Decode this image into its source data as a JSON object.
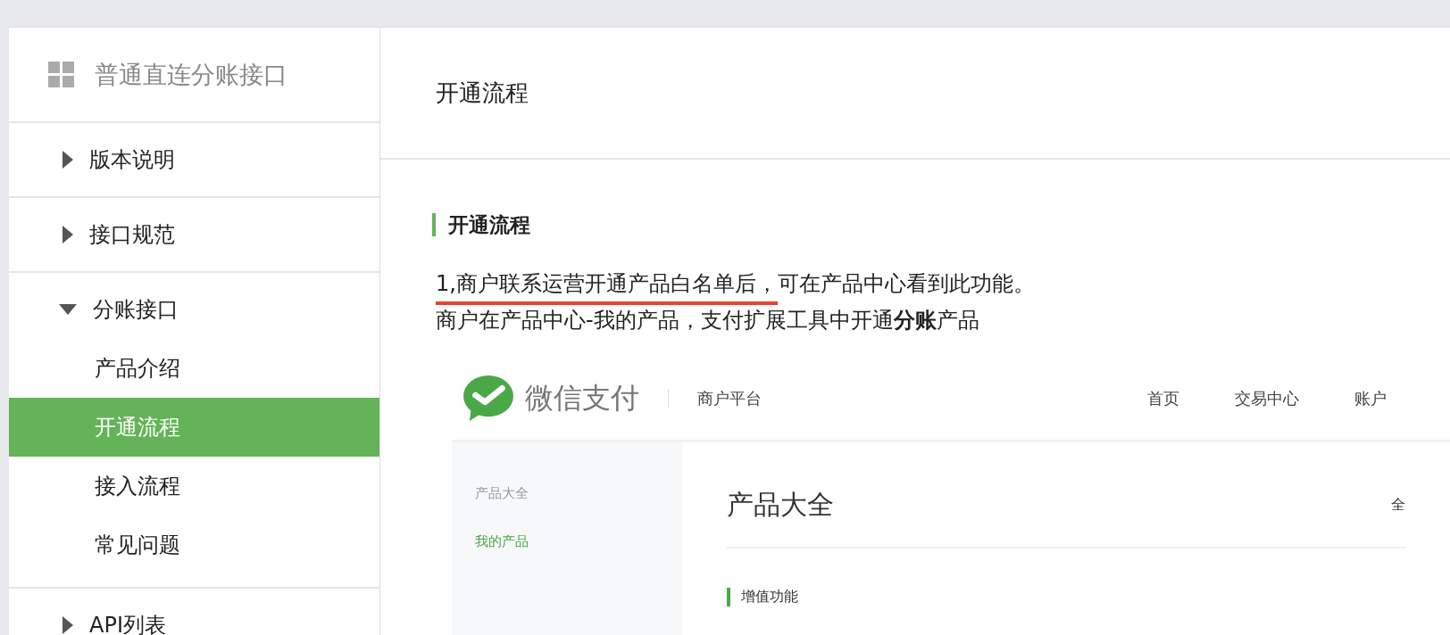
{
  "sidebar": {
    "title": "普通直连分账接口",
    "items": [
      {
        "label": "版本说明",
        "expanded": false
      },
      {
        "label": "接口规范",
        "expanded": false
      },
      {
        "label": "分账接口",
        "expanded": true,
        "children": [
          {
            "label": "产品介绍",
            "selected": false
          },
          {
            "label": "开通流程",
            "selected": true
          },
          {
            "label": "接入流程",
            "selected": false
          },
          {
            "label": "常见问题",
            "selected": false
          }
        ]
      },
      {
        "label": "API列表",
        "expanded": false
      }
    ]
  },
  "page": {
    "title": "开通流程",
    "section": "开通流程",
    "lines": [
      [
        {
          "text": "1,商户联系运营开通产品白名单后，",
          "underlined": true
        },
        {
          "text": "可在产品中心看到此功能。",
          "underlined": false
        }
      ],
      [
        {
          "text": "商户在产品中心-我的产品，支付扩展工具中开通**分账**产品",
          "underlined": false
        }
      ]
    ],
    "screenshot": {
      "brand": "微信支付",
      "platform": "商户平台",
      "nav": [
        "首页",
        "交易中心",
        "账户"
      ],
      "side": [
        {
          "label": "产品大全",
          "selected": false
        },
        {
          "label": "我的产品",
          "selected": true
        }
      ],
      "heading": "产品大全",
      "heading_right": "全",
      "subheading": "增值功能"
    }
  }
}
